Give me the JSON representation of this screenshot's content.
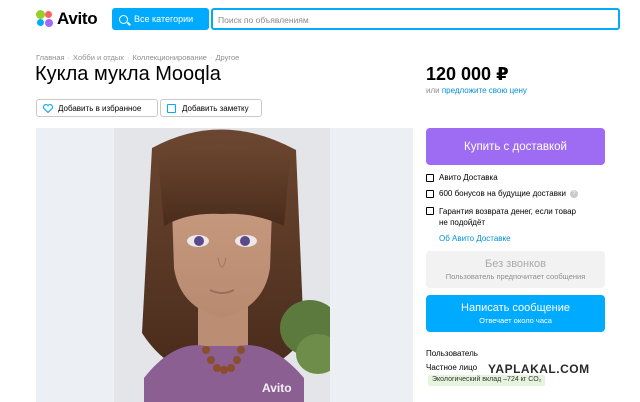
{
  "header": {
    "logo_text": "Avito",
    "categories_label": "Все категории",
    "search_placeholder": "Поиск по объявлениям"
  },
  "breadcrumbs": [
    "Главная",
    "Хобби и отдых",
    "Коллекционирование",
    "Другое"
  ],
  "listing": {
    "title": "Кукла мукла Mooqla",
    "price": "120 000 ₽",
    "price_prefix": "или ",
    "price_offer_link": "предложите свою цену",
    "add_favorite_label": "Добавить в избранное",
    "add_note_label": "Добавить заметку",
    "photo_watermark": "Avito"
  },
  "delivery": {
    "buy_button": "Купить с доставкой",
    "feature_1": "Авито Доставка",
    "feature_2": "600 бонусов на будущие доставки",
    "feature_3_line1": "Гарантия возврата денег, если товар",
    "feature_3_line2": "не подойдёт",
    "about_link": "Об Авито Доставке"
  },
  "contact": {
    "no_calls_title": "Без звонков",
    "no_calls_sub": "Пользователь предпочитает сообщения",
    "message_title": "Написать сообщение",
    "message_sub": "Отвечает около часа"
  },
  "seller": {
    "role": "Пользователь",
    "type": "Частное лицо",
    "eco_badge": "Экологический вклад –724 кг CO₂"
  },
  "overlay_watermark": "YAPLAKAL.COM",
  "colors": {
    "accent": "#00aaff",
    "purple": "#9d6cf3",
    "link": "#0091d9"
  }
}
